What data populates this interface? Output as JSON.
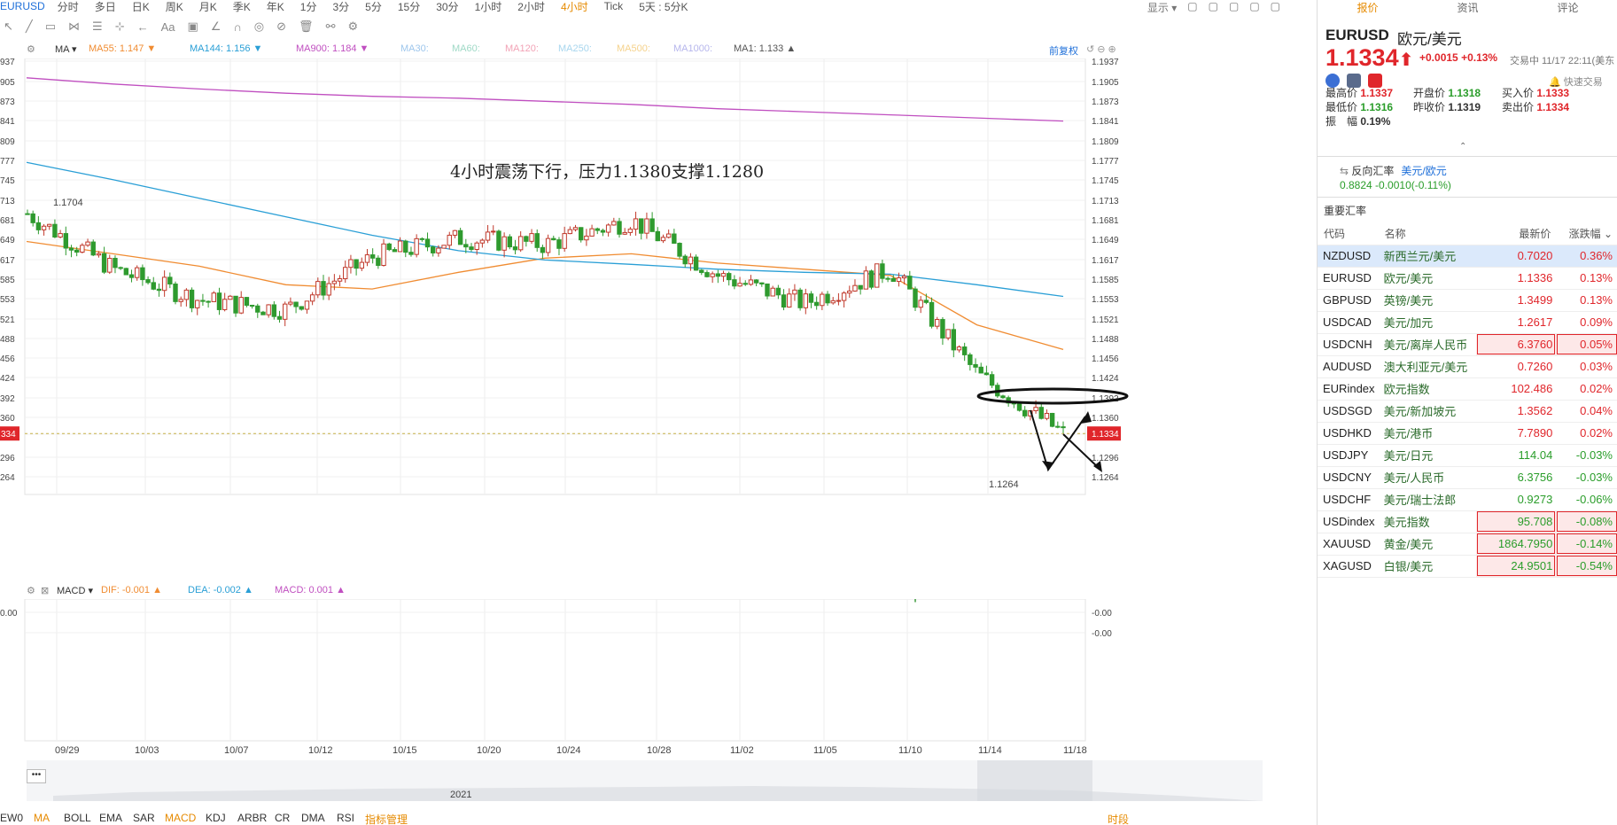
{
  "period_bar": {
    "symbol": "EURUSD",
    "periods": [
      "分时",
      "多日",
      "日K",
      "周K",
      "月K",
      "季K",
      "年K",
      "1分",
      "3分",
      "5分",
      "15分",
      "30分",
      "1小时",
      "2小时",
      "4小时",
      "Tick",
      "5天 : 5分K"
    ],
    "active": "4小时",
    "right": [
      "显示"
    ]
  },
  "tool_icons": [
    "cursor-icon",
    "line-icon",
    "rect-icon",
    "fib-icon",
    "channel-icon",
    "measure-icon",
    "arrow-icon",
    "text-icon",
    "note-icon",
    "pen-icon",
    "arc-icon",
    "cycle-icon",
    "erase-icon",
    "trash-icon",
    "link-icon",
    "settings-icon"
  ],
  "tool_text": "Aa",
  "ma_bar": {
    "label": "MA",
    "items": [
      {
        "text": "MA55: 1.147",
        "color": "#f08c32",
        "arrow": "▼"
      },
      {
        "text": "MA144: 1.156",
        "color": "#2a9fd6",
        "arrow": "▼"
      },
      {
        "text": "MA900: 1.184",
        "color": "#c04fc0",
        "arrow": "▼"
      },
      {
        "text": "MA30:",
        "color": "#9ec6ec",
        "arrow": ""
      },
      {
        "text": "MA60:",
        "color": "#9fd9c6",
        "arrow": ""
      },
      {
        "text": "MA120:",
        "color": "#f2a3b6",
        "arrow": ""
      },
      {
        "text": "MA250:",
        "color": "#a8d6ee",
        "arrow": ""
      },
      {
        "text": "MA500:",
        "color": "#f5d28c",
        "arrow": ""
      },
      {
        "text": "MA1000:",
        "color": "#b6b6ec",
        "arrow": ""
      },
      {
        "text": "MA1: 1.133",
        "color": "#555555",
        "arrow": "▲"
      }
    ],
    "adjust": "前复权"
  },
  "price_axis": [
    "1.1937",
    "1.1905",
    "1.1873",
    "1.1841",
    "1.1809",
    "1.1777",
    "1.1745",
    "1.1713",
    "1.1681",
    "1.1649",
    "1.1617",
    "1.1585",
    "1.1553",
    "1.1521",
    "1.1488",
    "1.1456",
    "1.1424",
    "1.1392",
    "1.1360",
    "1.1334",
    "1.1296",
    "1.1264"
  ],
  "left_axis": [
    "937",
    "905",
    "873",
    "841",
    "809",
    "777",
    "745",
    "713",
    "681",
    "649",
    "617",
    "585",
    "553",
    "521",
    "488",
    "456",
    "424",
    "392",
    "360",
    "334",
    "296",
    "264"
  ],
  "current_price_tag": "1.1334",
  "current_price_tag_left": "334",
  "annotation": "4小时震荡下行，压力1.1380支撑1.1280",
  "high_label": "1.1704",
  "low_label": "1.1264",
  "chart_data": {
    "type": "line",
    "title": "",
    "ylim": [
      1.125,
      1.195
    ],
    "x": [
      "09/29",
      "10/03",
      "10/07",
      "10/12",
      "10/15",
      "10/20",
      "10/24",
      "10/28",
      "11/02",
      "11/05",
      "11/10",
      "11/14",
      "11/18"
    ],
    "series": [
      {
        "name": "MA55",
        "values": [
          1.1645,
          1.1625,
          1.1605,
          1.1575,
          1.1568,
          1.1595,
          1.1618,
          1.1625,
          1.161,
          1.16,
          1.159,
          1.151,
          1.147
        ]
      },
      {
        "name": "MA144",
        "values": [
          1.1773,
          1.1745,
          1.1715,
          1.1685,
          1.1655,
          1.163,
          1.1615,
          1.1608,
          1.16,
          1.1595,
          1.1592,
          1.1575,
          1.1556
        ]
      },
      {
        "name": "MA900",
        "values": [
          1.191,
          1.19,
          1.1892,
          1.1885,
          1.188,
          1.1877,
          1.1872,
          1.1867,
          1.186,
          1.1855,
          1.185,
          1.1845,
          1.184
        ]
      },
      {
        "name": "MA1",
        "values": [
          1.169,
          1.16,
          1.155,
          1.1535,
          1.162,
          1.165,
          1.164,
          1.168,
          1.159,
          1.1545,
          1.16,
          1.143,
          1.1334
        ]
      }
    ]
  },
  "macd_bar": {
    "label": "MACD",
    "items": [
      {
        "text": "DIF: -0.001",
        "color": "#f08c32",
        "arrow": "▲"
      },
      {
        "text": "DEA: -0.002",
        "color": "#2a9fd6",
        "arrow": "▲"
      },
      {
        "text": "MACD: 0.001",
        "color": "#c04fc0",
        "arrow": "▲"
      }
    ]
  },
  "macd_axis": [
    "0.00",
    "0.00",
    "0.00",
    "-0.00",
    "-0.00",
    "-0.00"
  ],
  "macd_left_axis": [
    "0.00",
    "0.00",
    "0.00",
    "0.00",
    "0.00"
  ],
  "nav": {
    "dots": "•••",
    "year": "2021"
  },
  "indicator_bar": {
    "items": [
      "EW0",
      "MA",
      "BOLL",
      "EMA",
      "SAR",
      "MACD",
      "KDJ",
      "ARBR",
      "CR",
      "DMA",
      "RSI",
      "指标管理"
    ],
    "active": [
      "MA",
      "MACD"
    ],
    "right": "时段"
  },
  "side": {
    "tabs": [
      "报价",
      "资讯",
      "评论"
    ],
    "active_tab": "报价",
    "symbol": "EURUSD",
    "name": "欧元/美元",
    "price": "1.1334",
    "change": "+0.0015",
    "change_pct": "+0.13%",
    "time": "交易中 11/17 22:11(美东",
    "fast_trade": "快速交易",
    "stats": [
      {
        "label": "最高价",
        "value": "1.1337",
        "cls": "up"
      },
      {
        "label": "开盘价",
        "value": "1.1318",
        "cls": "down"
      },
      {
        "label": "买入价",
        "value": "1.1333",
        "cls": "up"
      },
      {
        "label": "最低价",
        "value": "1.1316",
        "cls": "down"
      },
      {
        "label": "昨收价",
        "value": "1.1319",
        "cls": ""
      },
      {
        "label": "卖出价",
        "value": "1.1334",
        "cls": "up"
      },
      {
        "label": "振　幅",
        "value": "0.19%",
        "cls": ""
      }
    ],
    "reverse_title": "反向汇率",
    "reverse_link": "美元/欧元",
    "reverse_value": "0.8824  -0.0010(-0.11%)",
    "important_title": "重要汇率",
    "table_headers": [
      "代码",
      "名称",
      "最新价",
      "涨跌幅"
    ],
    "rates": [
      {
        "code": "NZDUSD",
        "name": "新西兰元/美元",
        "price": "0.7020",
        "pct": "0.36%",
        "dir": "up",
        "boxed": false,
        "sel": true
      },
      {
        "code": "EURUSD",
        "name": "欧元/美元",
        "price": "1.1336",
        "pct": "0.13%",
        "dir": "up",
        "boxed": false,
        "sel": false
      },
      {
        "code": "GBPUSD",
        "name": "英镑/美元",
        "price": "1.3499",
        "pct": "0.13%",
        "dir": "up",
        "boxed": false,
        "sel": false
      },
      {
        "code": "USDCAD",
        "name": "美元/加元",
        "price": "1.2617",
        "pct": "0.09%",
        "dir": "up",
        "boxed": false,
        "sel": false
      },
      {
        "code": "USDCNH",
        "name": "美元/离岸人民币",
        "price": "6.3760",
        "pct": "0.05%",
        "dir": "up",
        "boxed": true,
        "sel": false
      },
      {
        "code": "AUDUSD",
        "name": "澳大利亚元/美元",
        "price": "0.7260",
        "pct": "0.03%",
        "dir": "up",
        "boxed": false,
        "sel": false
      },
      {
        "code": "EURindex",
        "name": "欧元指数",
        "price": "102.486",
        "pct": "0.02%",
        "dir": "up",
        "boxed": false,
        "sel": false
      },
      {
        "code": "USDSGD",
        "name": "美元/新加坡元",
        "price": "1.3562",
        "pct": "0.04%",
        "dir": "up",
        "boxed": false,
        "sel": false
      },
      {
        "code": "USDHKD",
        "name": "美元/港币",
        "price": "7.7890",
        "pct": "0.02%",
        "dir": "up",
        "boxed": false,
        "sel": false
      },
      {
        "code": "USDJPY",
        "name": "美元/日元",
        "price": "114.04",
        "pct": "-0.03%",
        "dir": "down",
        "boxed": false,
        "sel": false
      },
      {
        "code": "USDCNY",
        "name": "美元/人民币",
        "price": "6.3756",
        "pct": "-0.03%",
        "dir": "down",
        "boxed": false,
        "sel": false
      },
      {
        "code": "USDCHF",
        "name": "美元/瑞士法郎",
        "price": "0.9273",
        "pct": "-0.06%",
        "dir": "down",
        "boxed": false,
        "sel": false
      },
      {
        "code": "USDindex",
        "name": "美元指数",
        "price": "95.708",
        "pct": "-0.08%",
        "dir": "down",
        "boxed": true,
        "sel": false
      },
      {
        "code": "XAUUSD",
        "name": "黄金/美元",
        "price": "1864.7950",
        "pct": "-0.14%",
        "dir": "down",
        "boxed": true,
        "sel": false
      },
      {
        "code": "XAGUSD",
        "name": "白银/美元",
        "price": "24.9501",
        "pct": "-0.54%",
        "dir": "down",
        "boxed": true,
        "sel": false
      }
    ]
  }
}
